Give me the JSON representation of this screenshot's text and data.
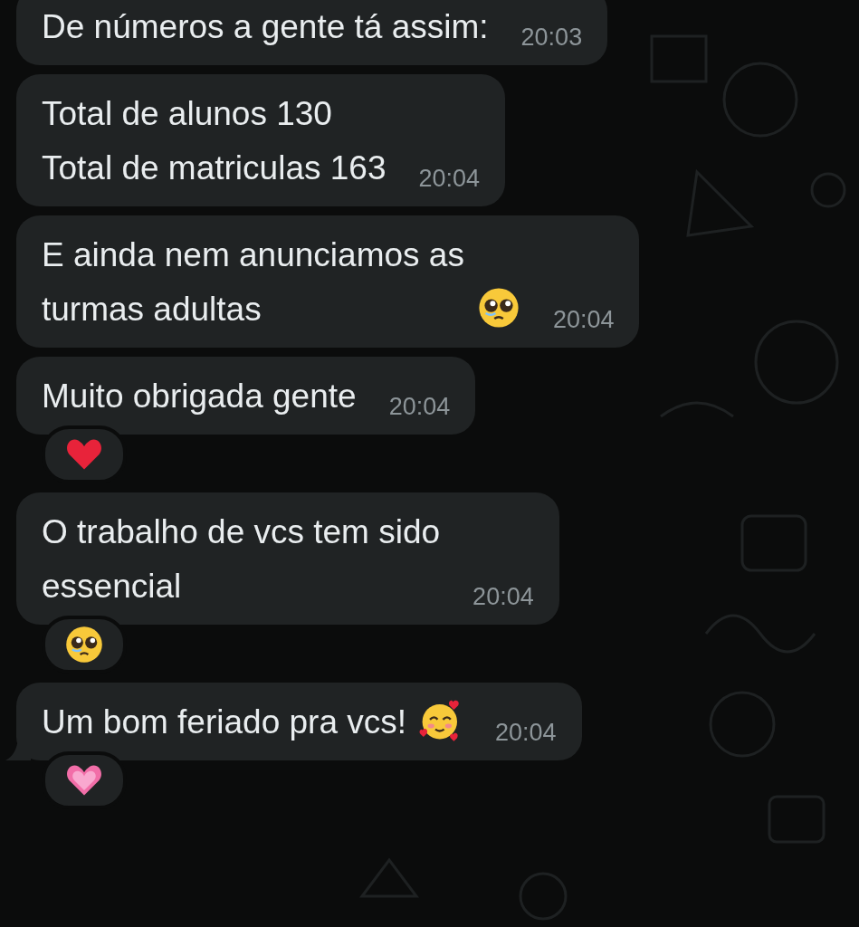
{
  "messages": [
    {
      "text": "De números a gente tá assim:",
      "time": "20:03"
    },
    {
      "text": "Total de alunos 130\nTotal de matriculas 163",
      "time": "20:04"
    },
    {
      "text": "E ainda nem anunciamos as\nturmas adultas",
      "emoji": {
        "kind": "pleading-face"
      },
      "time": "20:04"
    },
    {
      "text": "Muito obrigada gente",
      "time": "20:04",
      "reaction": {
        "kind": "red-heart"
      }
    },
    {
      "text": "O trabalho de vcs tem sido\nessencial",
      "time": "20:04",
      "reaction": {
        "kind": "pleading-face"
      }
    },
    {
      "text": "Um bom feriado pra vcs!",
      "emoji": {
        "kind": "hearts-face"
      },
      "time": "20:04",
      "reaction": {
        "kind": "pink-heart"
      },
      "tail": true
    }
  ]
}
